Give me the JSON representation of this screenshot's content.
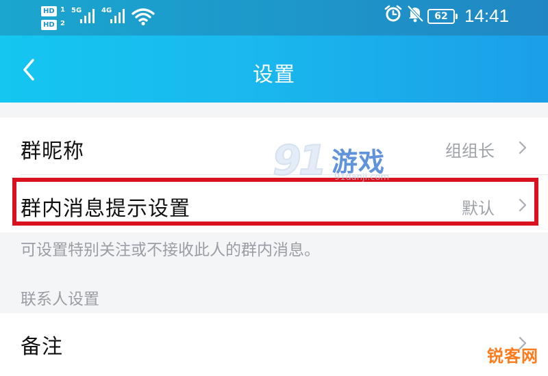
{
  "status_bar": {
    "sim1_badge": "HD",
    "sim1_num": "1",
    "sim2_badge": "HD",
    "sim2_num": "2",
    "net1": "5G",
    "net2": "4G",
    "battery": "62",
    "time": "14:41",
    "icons": [
      "signal-icon",
      "wifi-icon",
      "alarm-icon",
      "mute-bell-icon",
      "battery-icon"
    ]
  },
  "title_bar": {
    "title": "设置",
    "back_icon": "chevron-left-icon"
  },
  "settings": {
    "group_nickname": {
      "label": "群昵称",
      "value": "组组长"
    },
    "group_message_notify": {
      "label": "群内消息提示设置",
      "value": "默认"
    },
    "hint": "可设置特别关注或不接收此人的群内消息。",
    "contact_section_label": "联系人设置",
    "remark": {
      "label": "备注"
    }
  },
  "watermarks": {
    "brand_91_num": "91",
    "brand_91_text": "游戏",
    "brand_91_url": "91danji.com",
    "brand_ruike": "锐客网"
  },
  "colors": {
    "header_start": "#14c6f0",
    "header_end": "#1b9fe8",
    "highlight": "#d8131f",
    "secondary_text": "#9a9ea4",
    "watermark_blue": "#2a6fd0",
    "watermark_orange": "#ff7a1a"
  }
}
